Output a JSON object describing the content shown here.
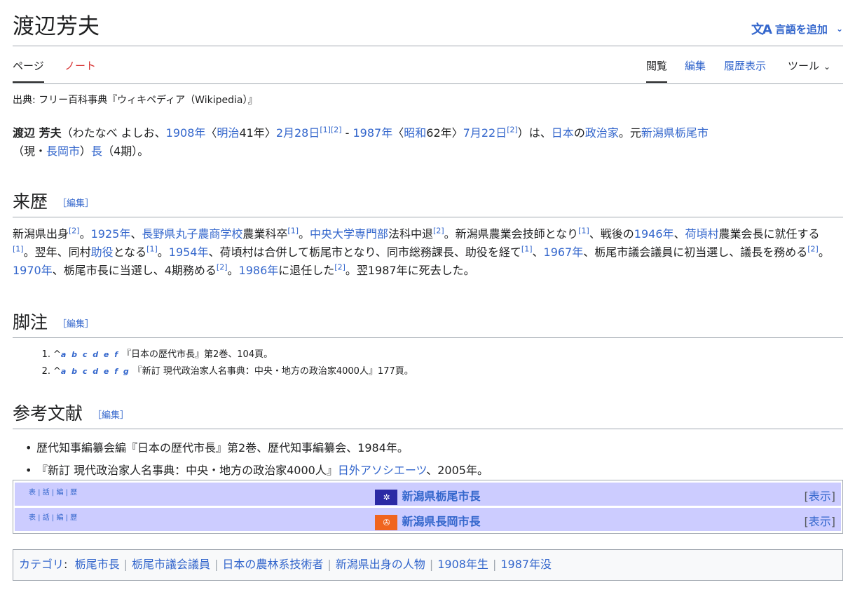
{
  "title": "渡辺芳夫",
  "lang_button": {
    "icon": "文A",
    "label": "言語を追加",
    "chevron": "⌄"
  },
  "tabs": {
    "page": "ページ",
    "talk": "ノート",
    "read": "閲覧",
    "edit": "編集",
    "history": "履歴表示",
    "tools": "ツール",
    "tools_chevron": "⌄"
  },
  "from": "出典: フリー百科事典『ウィキペディア（Wikipedia）』",
  "intro": {
    "name": "渡辺 芳夫",
    "t1": "（わたなべ よしお、",
    "l_1908": "1908年",
    "t2": "〈",
    "l_meiji": "明治",
    "t3": "41年〉",
    "l_feb28": "2月28日",
    "r1": "[1]",
    "r2": "[2]",
    "t4": " - ",
    "l_1987": "1987年",
    "t5": "〈",
    "l_showa": "昭和",
    "t6": "62年〉",
    "l_jul22": "7月22日",
    "r3": "[2]",
    "t7": "）は、",
    "l_japan": "日本",
    "t8": "の",
    "l_politician": "政治家",
    "t9": "。元",
    "l_tochio": "新潟県栃尾市",
    "t10": "（現・",
    "l_nagaoka": "長岡市",
    "t11": "）",
    "l_mayor": "長",
    "t12": "（4期）。"
  },
  "sections": {
    "history": "来歴",
    "notes": "脚注",
    "refs": "参考文献",
    "edit_label": "［編集］"
  },
  "body": {
    "t1": "新潟県出身",
    "r1": "[2]",
    "t2": "。",
    "l_1925": "1925年",
    "t3": "、",
    "l_school": "長野県丸子農商学校",
    "t4": "農業科卒",
    "r2": "[1]",
    "t5": "。",
    "l_chuo": "中央大学専門部",
    "t6": "法科中退",
    "r3": "[2]",
    "t7": "。新潟県農業会技師となり",
    "r4": "[1]",
    "t8": "、戦後の",
    "l_1946": "1946年",
    "t9": "、",
    "l_kake": "荷頃村",
    "t10": "農業会長に就任する",
    "r5": "[1]",
    "t11": "。翌年、同村",
    "l_joyaku": "助役",
    "t12": "となる",
    "r6": "[1]",
    "t13": "。",
    "l_1954": "1954年",
    "t14": "、荷頃村は合併して栃尾市となり、同市総務課長、助役を経て",
    "r7": "[1]",
    "t15": "、",
    "l_1967": "1967年",
    "t16": "、栃尾市議会議員に初当選し、議長を務める",
    "r8": "[2]",
    "t17": "。",
    "l_1970": "1970年",
    "t18": "、栃尾市長に当選し、4期務める",
    "r9": "[2]",
    "t19": "。",
    "l_1986": "1986年",
    "t20": "に退任した",
    "r10": "[2]",
    "t21": "。翌1987年に死去した。"
  },
  "notes": [
    {
      "num": "1.",
      "caret": "^",
      "backlinks": "a b c d e f",
      "text": "『日本の歴代市長』第2巻、104頁。"
    },
    {
      "num": "2.",
      "caret": "^",
      "backlinks": "a b c d e f g",
      "text": "『新訂 現代政治家人名事典：中央・地方の政治家4000人』177頁。"
    }
  ],
  "refs": {
    "item1": "歴代知事編纂会編『日本の歴代市長』第2巻、歴代知事編纂会、1984年。",
    "item2_pre": "『新訂 現代政治家人名事典：中央・地方の政治家4000人』",
    "item2_link": "日外アソシエーツ",
    "item2_post": "、2005年。"
  },
  "navboxes": [
    {
      "vte": "表 | 話 | 編 | 歴",
      "title": "新潟県栃尾市長",
      "flag": "✲",
      "toggle_open": "[",
      "toggle": "表示",
      "toggle_close": "]"
    },
    {
      "vte": "表 | 話 | 編 | 歴",
      "title": "新潟県長岡市長",
      "flag": "✇",
      "toggle_open": "[",
      "toggle": "表示",
      "toggle_close": "]"
    }
  ],
  "categories": {
    "label": "カテゴリ",
    "colon": ":",
    "items": [
      "栃尾市長",
      "栃尾市議会議員",
      "日本の農林系技術者",
      "新潟県出身の人物",
      "1908年生",
      "1987年没"
    ]
  },
  "colors": {
    "link": "#3366cc",
    "red_link": "#d73333",
    "navbox_header": "#ccccff",
    "flag_tochio": "#2b2aa5",
    "flag_nagaoka": "#f0651f"
  }
}
